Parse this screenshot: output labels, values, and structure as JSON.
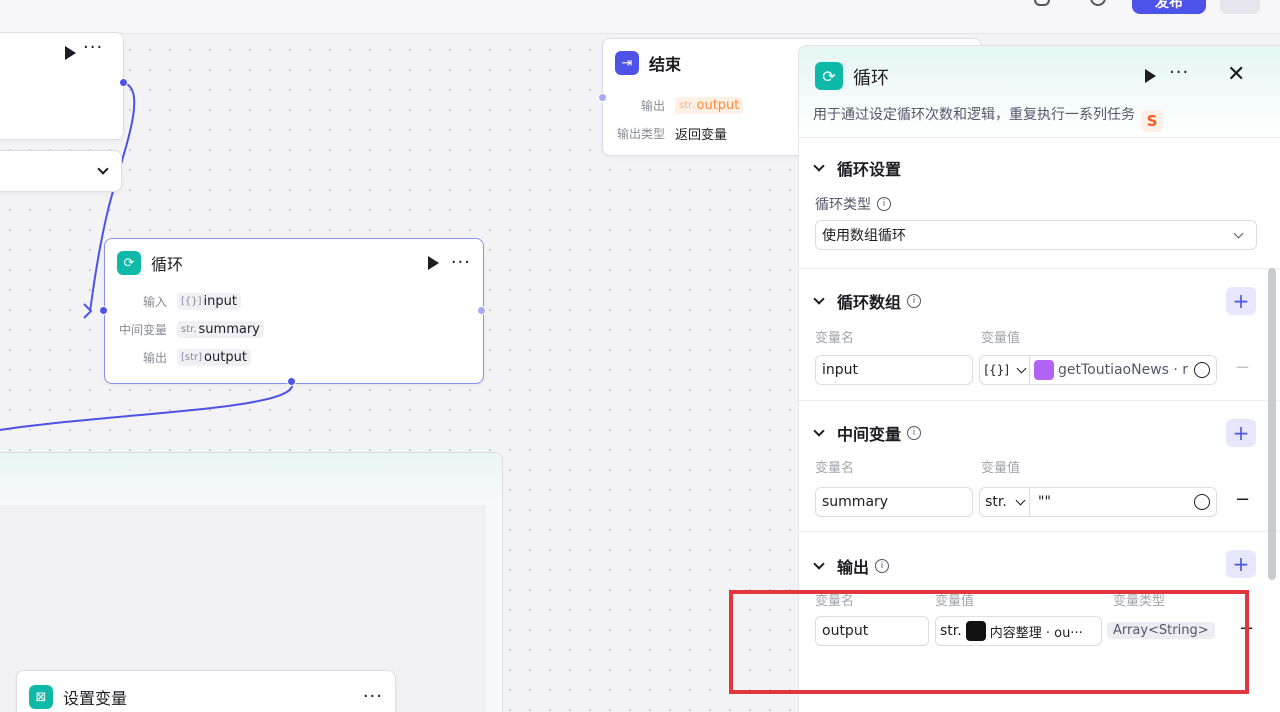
{
  "topbar": {
    "publish_label": "发布"
  },
  "canvas": {
    "end_node": {
      "title": "结束",
      "rows": [
        {
          "label": "输出",
          "type": "str.",
          "value": "output"
        },
        {
          "label": "输出类型",
          "value": "返回变量"
        }
      ]
    },
    "loop_node": {
      "title": "循环",
      "rows": [
        {
          "label": "输入",
          "type": "[{}]",
          "value": "input"
        },
        {
          "label": "中间变量",
          "type": "str.",
          "value": "summary"
        },
        {
          "label": "输出",
          "type": "[str]",
          "value": "output"
        }
      ]
    },
    "setvar_node": {
      "title": "设置变量"
    }
  },
  "panel": {
    "title": "循环",
    "description": "用于通过设定循环次数和逻辑，重复执行一系列任务",
    "settings": {
      "title": "循环设置",
      "loop_type_label": "循环类型",
      "loop_type_value": "使用数组循环"
    },
    "loop_array": {
      "title": "循环数组",
      "col_name": "变量名",
      "col_value": "变量值",
      "var_name": "input",
      "type_tag": "[{}]",
      "ref_value": "getToutiaoNews · r"
    },
    "intermediate": {
      "title": "中间变量",
      "col_name": "变量名",
      "col_value": "变量值",
      "var_name": "summary",
      "type_tag": "str.",
      "value": "\"\""
    },
    "output": {
      "title": "输出",
      "col_name": "变量名",
      "col_value": "变量值",
      "col_type": "变量类型",
      "var_name": "output",
      "type_tag": "str.",
      "ref_value": "内容整理 · ou···",
      "var_type": "Array<String>"
    }
  },
  "colors": {
    "accent": "#4d53e8",
    "teal": "#0fb9a8",
    "orange": "#ff8a3d",
    "highlight": "#e0363d"
  }
}
